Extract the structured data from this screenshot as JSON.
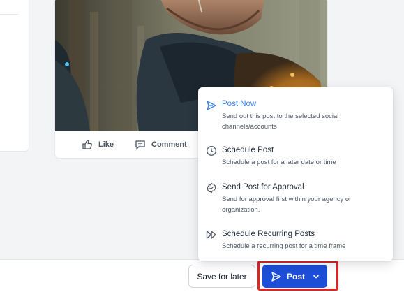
{
  "post_card": {
    "actions": [
      {
        "label": "Like",
        "icon": "thumbs-up-icon"
      },
      {
        "label": "Comment",
        "icon": "comment-icon"
      }
    ]
  },
  "footer": {
    "save_label": "Save for later",
    "post_label": "Post"
  },
  "post_menu": {
    "items": [
      {
        "title": "Post Now",
        "description": "Send out this post to the selected social channels/accounts",
        "icon": "send-icon",
        "active": true
      },
      {
        "title": "Schedule Post",
        "description": "Schedule a post for a later date or time",
        "icon": "clock-icon",
        "active": false
      },
      {
        "title": "Send Post for Approval",
        "description": "Send for approval first within your agency or organization.",
        "icon": "approval-check-icon",
        "active": false
      },
      {
        "title": "Schedule Recurring Posts",
        "description": "Schedule a recurring post for a time frame",
        "icon": "recurring-forward-icon",
        "active": false
      }
    ]
  },
  "colors": {
    "primary": "#1d4ed8",
    "active_item": "#3b82f6",
    "highlight": "#dc2626"
  }
}
